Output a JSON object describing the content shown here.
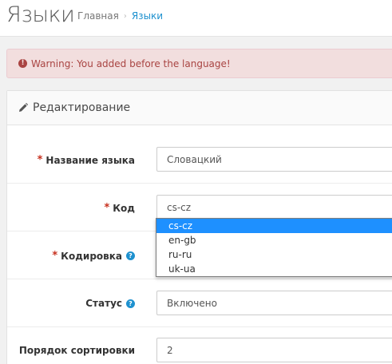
{
  "header": {
    "title": "Языки",
    "breadcrumb": {
      "home": "Главная",
      "separator": "›",
      "current": "Языки"
    }
  },
  "alert": {
    "icon": "exclamation-circle-icon",
    "text": "Warning: You added before the language!"
  },
  "panel": {
    "icon": "pencil-icon",
    "title": "Редактирование"
  },
  "form": {
    "required_mark": "*",
    "help_mark": "?",
    "name": {
      "label": "Название языка",
      "value": "Словацкий"
    },
    "code": {
      "label": "Код",
      "value": "cs-cz",
      "options": [
        "cs-cz",
        "en-gb",
        "ru-ru",
        "uk-ua"
      ],
      "highlighted_option": "cs-cz"
    },
    "locale": {
      "label": "Кодировка",
      "value": ""
    },
    "status": {
      "label": "Статус",
      "value": "Включено"
    },
    "sort_order": {
      "label": "Порядок сортировки",
      "value": "2"
    }
  },
  "colors": {
    "accent": "#1e91cf",
    "alert_bg": "#f2dede",
    "alert_text": "#a94442",
    "required": "#c72f1d",
    "selected_option": "#1e90ff"
  }
}
